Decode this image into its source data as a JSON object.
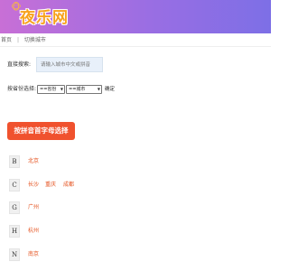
{
  "header": {
    "logo_text": "夜乐网",
    "logo_mascot": "🐵"
  },
  "breadcrumb": {
    "home": "首页",
    "separator": "|",
    "current": "切换城市"
  },
  "search": {
    "label": "直接搜索:",
    "placeholder": "请输入城市中文或拼音"
  },
  "province_select": {
    "label": "按省份选择:",
    "province_value": "==省份",
    "city_value": "==城市",
    "confirm_label": "确定"
  },
  "pinyin_button": "按拼音首字母选择",
  "letter_groups": [
    {
      "letter": "B",
      "cities": [
        "北京"
      ]
    },
    {
      "letter": "C",
      "cities": [
        "长沙",
        "重庆",
        "成都"
      ]
    },
    {
      "letter": "G",
      "cities": [
        "广州"
      ]
    },
    {
      "letter": "H",
      "cities": [
        "杭州"
      ]
    },
    {
      "letter": "N",
      "cities": [
        "南京"
      ]
    }
  ],
  "colors": {
    "header_gradient_start": "#c86fd6",
    "header_gradient_end": "#7d6fe6",
    "accent": "#f0522e",
    "city_link": "#e5521f",
    "logo": "#f7a21d"
  }
}
